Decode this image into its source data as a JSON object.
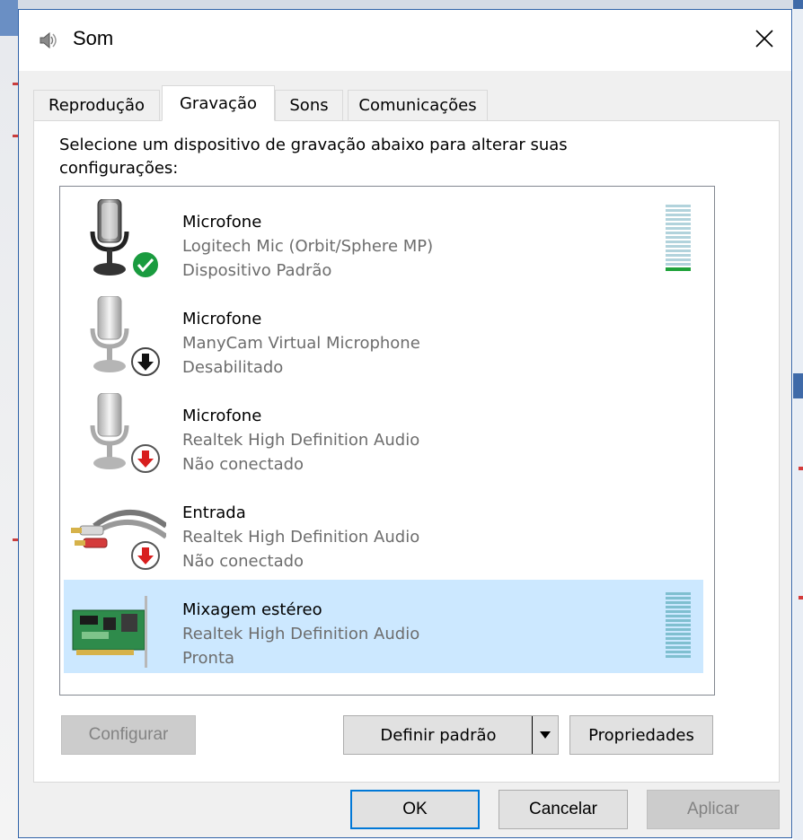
{
  "window": {
    "title": "Som",
    "close_glyph": "✕"
  },
  "tabs": [
    {
      "label": "Reprodução",
      "active": false
    },
    {
      "label": "Gravação",
      "active": true
    },
    {
      "label": "Sons",
      "active": false
    },
    {
      "label": "Comunicações",
      "active": false
    }
  ],
  "panel": {
    "instructions": "Selecione um dispositivo de gravação abaixo para alterar suas configurações:"
  },
  "devices": [
    {
      "name": "Microfone",
      "description": "Logitech Mic (Orbit/Sphere MP)",
      "status": "Dispositivo Padrão",
      "icon": "microphone-icon",
      "badge": "default-check-icon",
      "selected": false,
      "level_meter": true
    },
    {
      "name": "Microfone",
      "description": "ManyCam Virtual Microphone",
      "status": "Desabilitado",
      "icon": "microphone-icon",
      "badge": "disabled-arrow-icon",
      "selected": false,
      "level_meter": false
    },
    {
      "name": "Microfone",
      "description": "Realtek High Definition Audio",
      "status": "Não conectado",
      "icon": "microphone-icon",
      "badge": "unplugged-arrow-icon",
      "selected": false,
      "level_meter": false
    },
    {
      "name": "Entrada",
      "description": "Realtek High Definition Audio",
      "status": "Não conectado",
      "icon": "rca-cable-icon",
      "badge": "unplugged-arrow-icon",
      "selected": false,
      "level_meter": false
    },
    {
      "name": "Mixagem estéreo",
      "description": "Realtek High Definition Audio",
      "status": "Pronta",
      "icon": "sound-card-icon",
      "badge": "",
      "selected": true,
      "level_meter": true
    }
  ],
  "buttons": {
    "configure": "Configurar",
    "set_default": "Definir padrão",
    "properties": "Propriedades",
    "ok": "OK",
    "cancel": "Cancelar",
    "apply": "Aplicar"
  },
  "colors": {
    "accent": "#0078d7",
    "selected_row": "#cce8ff",
    "level_active": "#1fa23a",
    "level_idle": "#b2d3dc",
    "badge_check": "#1a9b3f",
    "badge_unplugged": "#d81e1e"
  }
}
